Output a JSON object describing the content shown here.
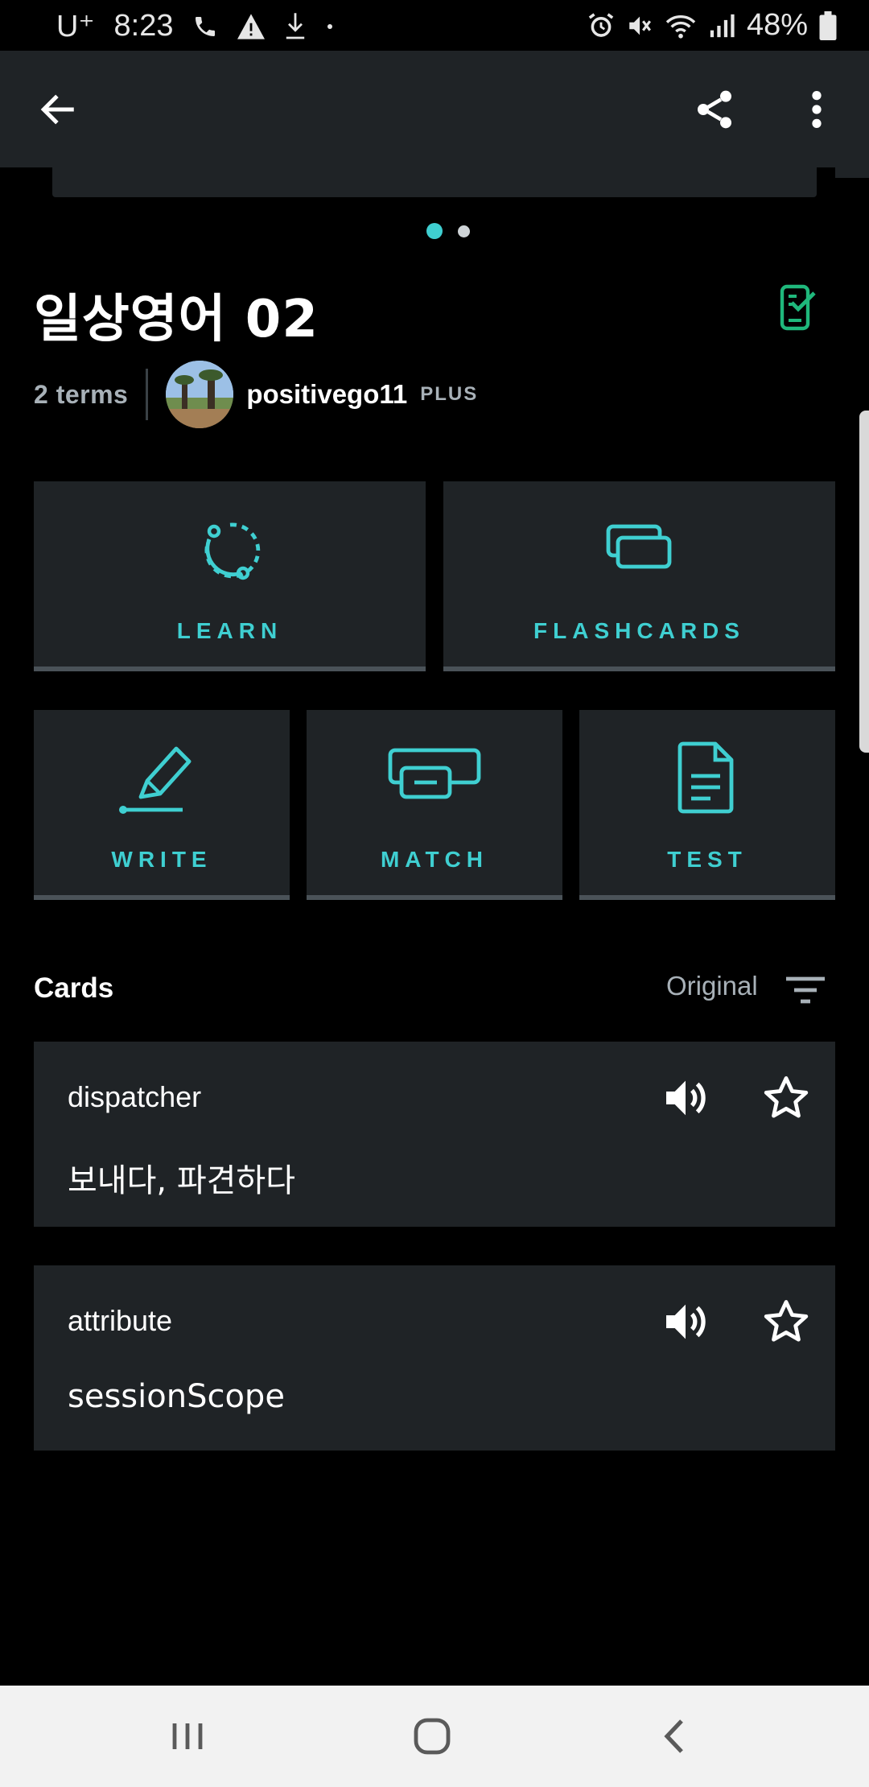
{
  "status_bar": {
    "carrier": "U⁺",
    "time": "8:23",
    "battery": "48%"
  },
  "app_bar": {
    "back_icon": "arrow-left-icon",
    "share_icon": "share-icon",
    "menu_icon": "more-vertical-icon"
  },
  "carousel": {
    "pages": 2,
    "active_index": 0,
    "active_color": "#3fcfd1",
    "inactive_color": "#cfd4d7"
  },
  "set": {
    "title": "일상영어 02",
    "terms_count": "2 terms",
    "username": "positivego11",
    "badge": "PLUS"
  },
  "modes": [
    {
      "label": "LEARN",
      "icon": "learn-icon"
    },
    {
      "label": "FLASHCARDS",
      "icon": "flashcards-icon"
    },
    {
      "label": "WRITE",
      "icon": "write-icon"
    },
    {
      "label": "MATCH",
      "icon": "match-icon"
    },
    {
      "label": "TEST",
      "icon": "test-icon"
    }
  ],
  "cards_section": {
    "heading": "Cards",
    "sort_label": "Original"
  },
  "cards": [
    {
      "term": "dispatcher",
      "definition": "보내다, 파견하다"
    },
    {
      "term": "attribute",
      "definition": "sessionScope"
    }
  ],
  "colors": {
    "accent": "#3fcfd1",
    "tile_bg": "#1f2326",
    "check_icon": "#1fb87c"
  }
}
